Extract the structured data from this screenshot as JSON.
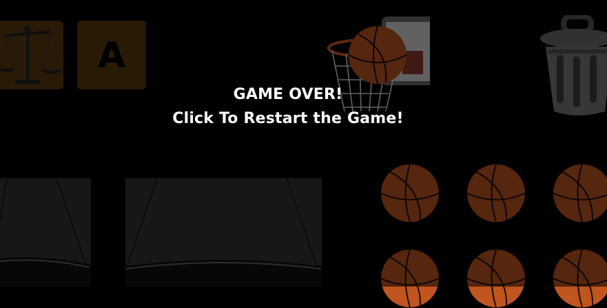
{
  "overlay": {
    "line1": "GAME OVER!",
    "line2": "Click To Restart the Game!"
  },
  "tiles": {
    "letter": "A"
  },
  "icons": [
    "scale-icon",
    "letter-a-icon",
    "basketball-hoop-icon",
    "trash-can-icon",
    "scale-pan-icon",
    "basketball-icon"
  ],
  "colors": {
    "background": "#000000",
    "tile": "#5b3a12",
    "ball": "#c0551f",
    "overlay_text": "#ffffff"
  }
}
